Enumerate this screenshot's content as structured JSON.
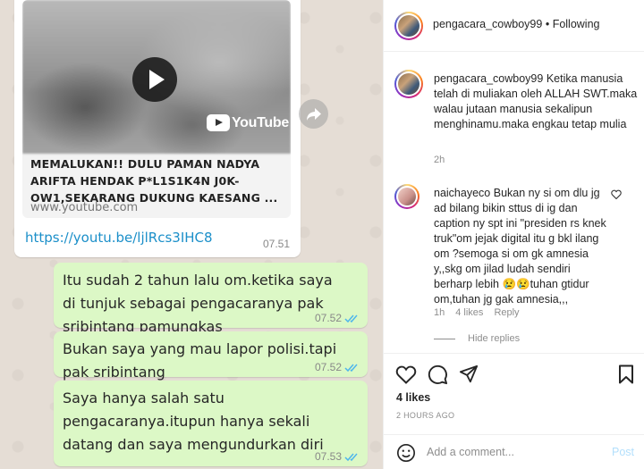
{
  "whatsapp": {
    "link_preview": {
      "video_brand": "YouTube",
      "title": "MEMALUKAN!! DULU PAMAN NADYA ARIFTA HENDAK P*L1S1K4N J0K-OW1,SEKARANG DUKUNG KAESANG ...",
      "domain": "www.youtube.com"
    },
    "incoming_message": {
      "url": "https://youtu.be/ljlRcs3IHC8",
      "time": "07.51"
    },
    "outgoing_messages": [
      {
        "lines": [
          "Itu sudah 2 tahun lalu om.ketika saya",
          "di tunjuk sebagai pengacaranya pak",
          "sribintang pamungkas"
        ],
        "time": "07.52"
      },
      {
        "lines": [
          "Bukan saya yang mau lapor polisi.tapi",
          "pak sribintang"
        ],
        "time": "07.52"
      },
      {
        "lines": [
          "Saya hanya salah satu",
          "pengacaranya.itupun hanya sekali",
          "datang dan saya mengundurkan diri"
        ],
        "time": "07.53"
      }
    ],
    "colors": {
      "background": "#e5ddd5",
      "outgoing_bubble": "#dcf8c6",
      "incoming_bubble": "#ffffff",
      "link": "#1b8fc9",
      "read_ticks": "#4fb6ec"
    }
  },
  "instagram": {
    "header": {
      "username": "pengacara_cowboy99",
      "separator": "•",
      "follow_status": "Following"
    },
    "caption": {
      "username": "pengacara_cowboy99",
      "text": "Ketika manusia telah di muliakan oleh ALLAH SWT.maka walau jutaan manusia sekalipun menghinamu.maka engkau tetap mulia",
      "time": "2h"
    },
    "comment": {
      "username": "naichayeco",
      "text": "Bukan ny si om dlu jg ad bilang bikin sttus di ig dan caption ny spt ini \"presiden rs knek truk\"om jejak digital itu g bkl ilang om ?semoga si om gk amnesia y,,skg om jilad ludah sendiri berharp lebih 😢😢tuhan gtidur om,tuhan jg gak amnesia,,,",
      "time": "1h",
      "likes": "4 likes",
      "reply": "Reply"
    },
    "hide_replies": "Hide replies",
    "likes_total": "4 likes",
    "posted_ago": "2 HOURS AGO",
    "add_comment_placeholder": "Add a comment...",
    "post_button": "Post",
    "icons": [
      "heart-icon",
      "comment-icon",
      "share-icon",
      "bookmark-icon",
      "emoji-icon"
    ]
  }
}
